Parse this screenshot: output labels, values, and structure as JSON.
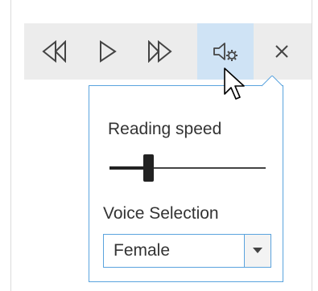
{
  "toolbar": {
    "buttons": [
      {
        "name": "previous",
        "icon": "skip-previous-icon"
      },
      {
        "name": "play",
        "icon": "play-icon"
      },
      {
        "name": "next",
        "icon": "skip-next-icon"
      },
      {
        "name": "voice-settings",
        "icon": "voice-settings-icon",
        "active": true
      },
      {
        "name": "close",
        "icon": "close-icon"
      }
    ]
  },
  "settings_popup": {
    "reading_speed_label": "Reading speed",
    "reading_speed_fraction": 0.25,
    "voice_selection_label": "Voice Selection",
    "voice_selected": "Female"
  },
  "colors": {
    "toolbar_bg": "#ececec",
    "active_button_bg": "#cfe3f5",
    "popup_border": "#5aa3de",
    "text": "#333333"
  }
}
